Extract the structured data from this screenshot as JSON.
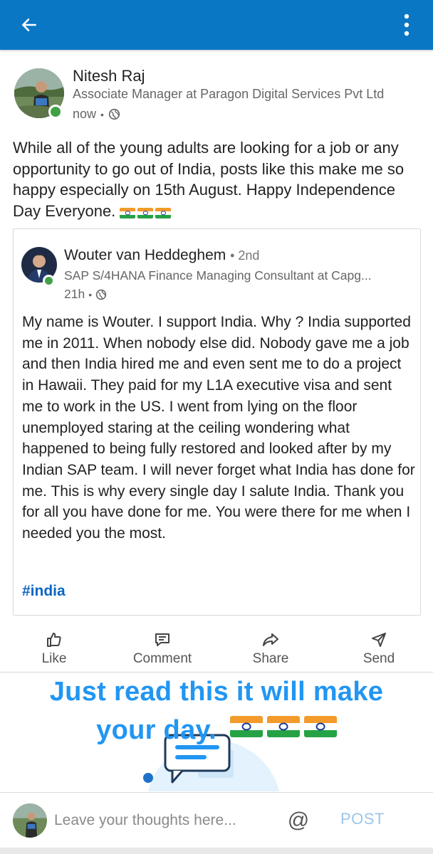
{
  "topbar": {
    "back_icon": "arrow-left-icon",
    "menu_icon": "more-vertical-icon",
    "color": "#0a77c5"
  },
  "post": {
    "author": {
      "name": "Nitesh Raj",
      "headline": "Associate Manager at Paragon Digital Services Pvt Ltd",
      "time": "now",
      "visibility_icon": "globe-icon",
      "online": true
    },
    "text": "While all of the young adults are looking for a job or any opportunity to go out of India, posts like this make me so happy especially on 15th August. Happy Independence Day Everyone.",
    "flag_count": 3
  },
  "shared": {
    "author": {
      "name": "Wouter van Heddeghem",
      "degree": "• 2nd",
      "headline": "SAP S/4HANA Finance Managing Consultant at Capg...",
      "time": "21h",
      "visibility_icon": "globe-icon",
      "online": true
    },
    "text": "My name is Wouter. I support India. Why ? India supported me in 2011. When nobody else did. Nobody gave me a job and then India hired me and even sent me to do a project in Hawaii. They paid for my L1A executive visa and sent me to work in the US. I went from lying on the floor unemployed  staring at the ceiling wondering what happened to being fully restored and looked after by my Indian SAP team. I will never forget what India has done for me. This is why every single day I salute India. Thank you for all you have done for me. You were there for me when I needed you the most.",
    "hashtag": "#india"
  },
  "actions": [
    {
      "label": "Like",
      "icon": "thumbs-up-icon"
    },
    {
      "label": "Comment",
      "icon": "comment-icon"
    },
    {
      "label": "Share",
      "icon": "share-icon"
    },
    {
      "label": "Send",
      "icon": "send-icon"
    }
  ],
  "image": {
    "line1": "Just read this it will make",
    "line2": "your day.",
    "text_color": "#2196f3"
  },
  "comment_bar": {
    "placeholder": "Leave your thoughts here...",
    "mention_symbol": "@",
    "post_label": "POST",
    "post_color": "#9cc6ea"
  }
}
